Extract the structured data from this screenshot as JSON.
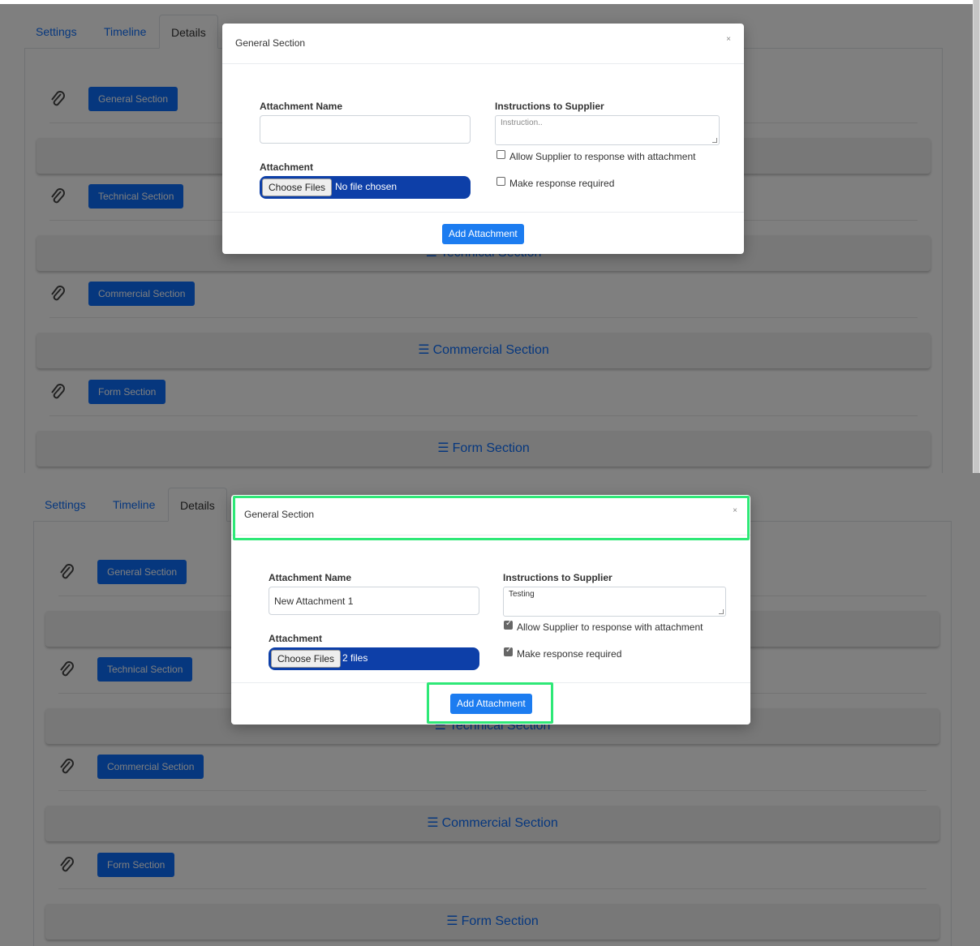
{
  "tabs": [
    "Settings",
    "Timeline",
    "Details"
  ],
  "sections": [
    "General Section",
    "Technical Section",
    "Commercial Section",
    "Form Section"
  ],
  "modal": {
    "title": "General Section",
    "close": "×",
    "attachment_name_label": "Attachment Name",
    "attachment_label": "Attachment",
    "instructions_label": "Instructions to Supplier",
    "instructions_placeholder": "Instruction..",
    "choose_files": "Choose Files",
    "allow_label": "Allow Supplier to response with attachment",
    "required_label": "Make response required",
    "add_button": "Add Attachment"
  },
  "before": {
    "attachment_name": "",
    "file_status": "No file chosen",
    "instructions": "",
    "allow_checked": false,
    "required_checked": false
  },
  "after": {
    "attachment_name": "New Attachment 1",
    "file_status": "2 files",
    "instructions": "Testing",
    "allow_checked": true,
    "required_checked": true
  },
  "partial_bar_text": "Technical Section",
  "highlight_color": "#2ee877",
  "primary_color": "#0d6efd"
}
